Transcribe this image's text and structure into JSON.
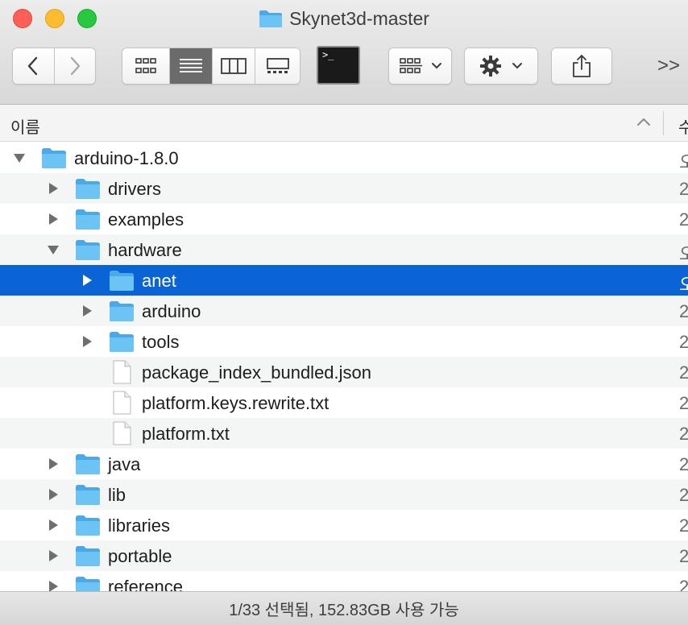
{
  "window": {
    "title": "Skynet3d-master",
    "title_icon": "folder-icon"
  },
  "toolbar": {
    "back_icon": "chevron-left-icon",
    "forward_icon": "chevron-right-icon",
    "views": [
      {
        "id": "icon",
        "icon": "icon-view-icon",
        "active": false
      },
      {
        "id": "list",
        "icon": "list-view-icon",
        "active": true
      },
      {
        "id": "column",
        "icon": "column-view-icon",
        "active": false
      },
      {
        "id": "gallery",
        "icon": "gallery-view-icon",
        "active": false
      }
    ],
    "terminal_prompt": ">_",
    "group_icon": "group-by-icon",
    "action_icon": "gear-icon",
    "share_icon": "share-icon",
    "overflow_label": ">>"
  },
  "columns": {
    "name": "이름",
    "next": "수"
  },
  "rows": [
    {
      "name": "arduino-1.8.0",
      "kind": "folder",
      "depth": 0,
      "expanded": true,
      "date": "오"
    },
    {
      "name": "drivers",
      "kind": "folder",
      "depth": 1,
      "expanded": false,
      "date": "2"
    },
    {
      "name": "examples",
      "kind": "folder",
      "depth": 1,
      "expanded": false,
      "date": "2"
    },
    {
      "name": "hardware",
      "kind": "folder",
      "depth": 1,
      "expanded": true,
      "date": "오"
    },
    {
      "name": "anet",
      "kind": "folder",
      "depth": 2,
      "expanded": false,
      "date": "오",
      "selected": true
    },
    {
      "name": "arduino",
      "kind": "folder",
      "depth": 2,
      "expanded": false,
      "date": "2"
    },
    {
      "name": "tools",
      "kind": "folder",
      "depth": 2,
      "expanded": false,
      "date": "2"
    },
    {
      "name": "package_index_bundled.json",
      "kind": "file",
      "depth": 2,
      "date": "2"
    },
    {
      "name": "platform.keys.rewrite.txt",
      "kind": "file",
      "depth": 2,
      "date": "2"
    },
    {
      "name": "platform.txt",
      "kind": "file",
      "depth": 2,
      "date": "2"
    },
    {
      "name": "java",
      "kind": "folder",
      "depth": 1,
      "expanded": false,
      "date": "2"
    },
    {
      "name": "lib",
      "kind": "folder",
      "depth": 1,
      "expanded": false,
      "date": "2"
    },
    {
      "name": "libraries",
      "kind": "folder",
      "depth": 1,
      "expanded": false,
      "date": "2"
    },
    {
      "name": "portable",
      "kind": "folder",
      "depth": 1,
      "expanded": false,
      "date": "2"
    },
    {
      "name": "reference",
      "kind": "folder",
      "depth": 1,
      "expanded": false,
      "date": "2"
    }
  ],
  "status": {
    "text": "1/33 선택됨, 152.83GB 사용 가능"
  },
  "colors": {
    "selection": "#0a64d6",
    "folder": "#6cc4f5",
    "folder_dark": "#4aa9e6"
  }
}
